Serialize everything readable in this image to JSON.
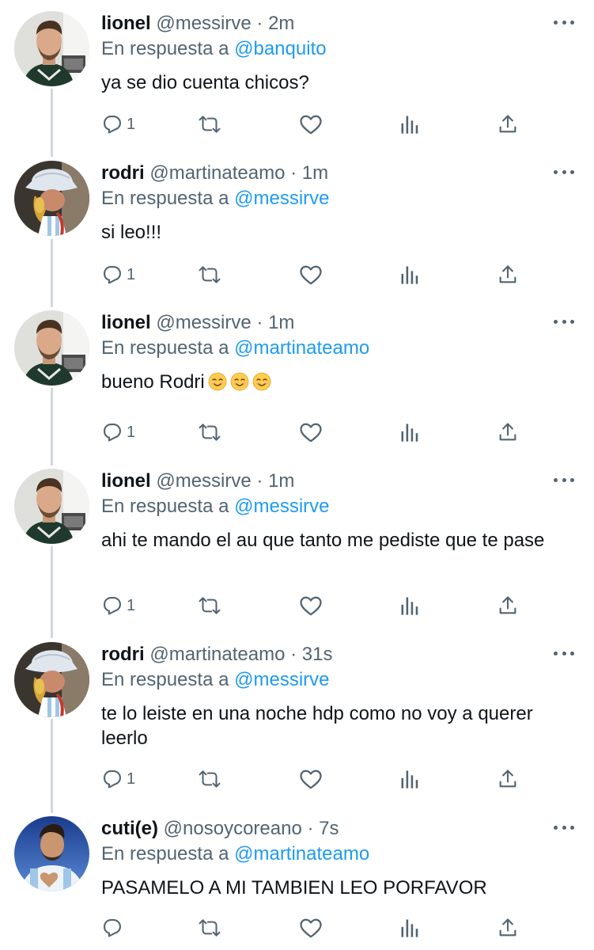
{
  "colors": {
    "link": "#1d9bf0",
    "secondary": "#536471",
    "text": "#0f1419",
    "line": "#cfd9de"
  },
  "reply_prefix": "En respuesta a",
  "tweets": [
    {
      "name": "lionel",
      "handle": "@messirve",
      "dot": "·",
      "time": "2m",
      "reply_to": "@banquito",
      "text": "ya se dio cuenta chicos?",
      "reply_count": "1",
      "avatar": "lionel-avatar"
    },
    {
      "name": "rodri",
      "handle": "@martinateamo",
      "dot": "·",
      "time": "1m",
      "reply_to": "@messirve",
      "text": "si leo!!!",
      "reply_count": "1",
      "avatar": "rodri-avatar"
    },
    {
      "name": "lionel",
      "handle": "@messirve",
      "dot": "·",
      "time": "1m",
      "reply_to": "@martinateamo",
      "text": "bueno Rodri",
      "emojis": [
        "smiling-face-emoji",
        "smiling-face-emoji",
        "smiling-face-emoji"
      ],
      "reply_count": "1",
      "avatar": "lionel-avatar"
    },
    {
      "name": "lionel",
      "handle": "@messirve",
      "dot": "·",
      "time": "1m",
      "reply_to": "@messirve",
      "text": "ahi te mando el au que tanto me pediste que te pase",
      "reply_count": "1",
      "avatar": "lionel-avatar"
    },
    {
      "name": "rodri",
      "handle": "@martinateamo",
      "dot": "·",
      "time": "31s",
      "reply_to": "@messirve",
      "text": "te lo leiste en una noche hdp como no voy a querer leerlo",
      "reply_count": "1",
      "avatar": "rodri-avatar"
    },
    {
      "name": "cuti(e)",
      "handle": "@nosoycoreano",
      "dot": "·",
      "time": "7s",
      "reply_to": "@martinateamo",
      "text": "PASAMELO A MI TAMBIEN LEO PORFAVOR",
      "reply_count": "",
      "avatar": "cuti-avatar"
    }
  ],
  "icons": {
    "reply": "reply-icon",
    "retweet": "retweet-icon",
    "like": "heart-icon",
    "views": "views-icon",
    "share": "share-icon",
    "more": "more-icon"
  }
}
